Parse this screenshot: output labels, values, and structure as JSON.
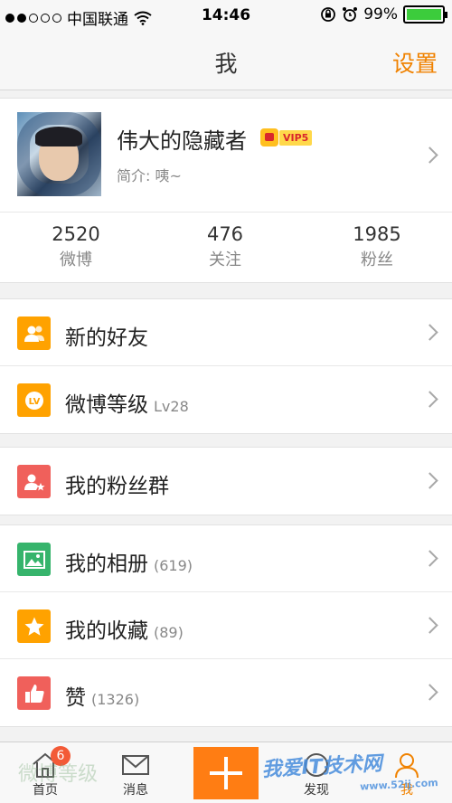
{
  "status": {
    "carrier": "中国联通",
    "time": "14:46",
    "battery": "99%",
    "signal_bars": 2,
    "battery_level": 0.99
  },
  "nav": {
    "title": "我",
    "settings": "设置"
  },
  "profile": {
    "name": "伟大的隐藏者",
    "vip": "VIP5",
    "intro": "简介: 咦~",
    "stats": [
      {
        "value": "2520",
        "label": "微博"
      },
      {
        "value": "476",
        "label": "关注"
      },
      {
        "value": "1985",
        "label": "粉丝"
      }
    ]
  },
  "menu": {
    "groups": [
      [
        {
          "label": "新的好友",
          "count": "",
          "icon": "friends-icon",
          "color": "#ffa200"
        },
        {
          "label": "微博等级",
          "count": "Lv28",
          "icon": "level-icon",
          "color": "#ffa200"
        }
      ],
      [
        {
          "label": "我的粉丝群",
          "count": "",
          "icon": "fans-group-icon",
          "color": "#f0605b"
        }
      ],
      [
        {
          "label": "我的相册",
          "count": "(619)",
          "icon": "album-icon",
          "color": "#36b46c"
        },
        {
          "label": "我的收藏",
          "count": "(89)",
          "icon": "favorites-icon",
          "color": "#ffa200"
        },
        {
          "label": "赞",
          "count": "(1326)",
          "icon": "like-icon",
          "color": "#f0605b"
        }
      ]
    ]
  },
  "tabbar": {
    "home": "首页",
    "home_badge": "6",
    "messages": "消息",
    "discover": "发现",
    "me": "我",
    "accent": "#ff7d13"
  },
  "overlay": {
    "ghost": "微博等级",
    "watermark": "我爱IT技术网",
    "watermark_url": "www.52ij.com"
  }
}
